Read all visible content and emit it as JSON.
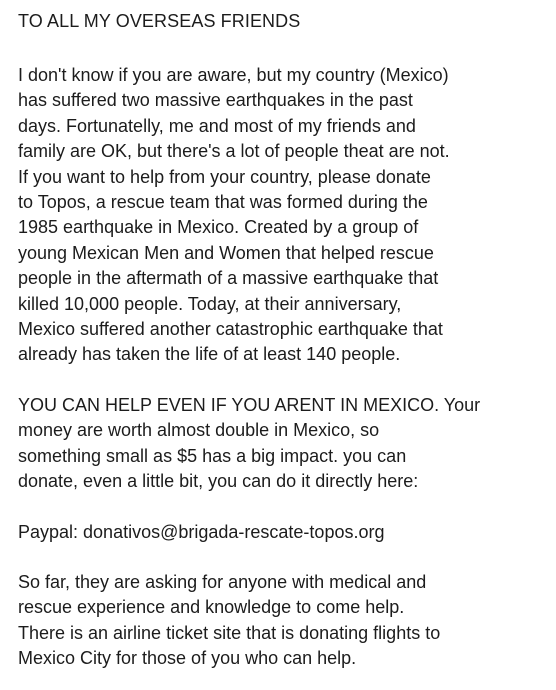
{
  "document": {
    "title": "TO ALL MY OVERSEAS FRIENDS",
    "paragraphs": [
      {
        "lines": [
          "I don't know if you are aware, but my country (Mexico)",
          "has suffered two massive earthquakes in the past",
          "days. Fortunatelly, me and most of my friends and",
          "family are OK, but there's a lot of people theat are not.",
          "If you want to help from your country,  please donate",
          "to Topos, a rescue team that was formed during the",
          "1985 earthquake in Mexico. Created by a group of",
          "young Mexican Men and Women that helped rescue",
          "people in the aftermath of a massive earthquake that",
          "killed 10,000 people. Today, at their anniversary,",
          "Mexico suffered another catastrophic earthquake that",
          "already has taken the life of at least 140 people."
        ]
      },
      {
        "lines": [
          "YOU CAN HELP EVEN IF YOU ARENT IN MEXICO. Your",
          "money are worth almost double in Mexico, so",
          "something small as $5 has a big impact. you can",
          "donate, even a little bit, you can do it directly here:"
        ]
      },
      {
        "lines": [
          "Paypal: donativos@brigada-rescate-topos.org"
        ]
      },
      {
        "lines": [
          "So far, they are asking for anyone with medical and",
          "rescue experience and knowledge to come help.",
          "There is an airline ticket site that is donating flights to",
          "Mexico City for those of you who can help."
        ]
      }
    ]
  }
}
